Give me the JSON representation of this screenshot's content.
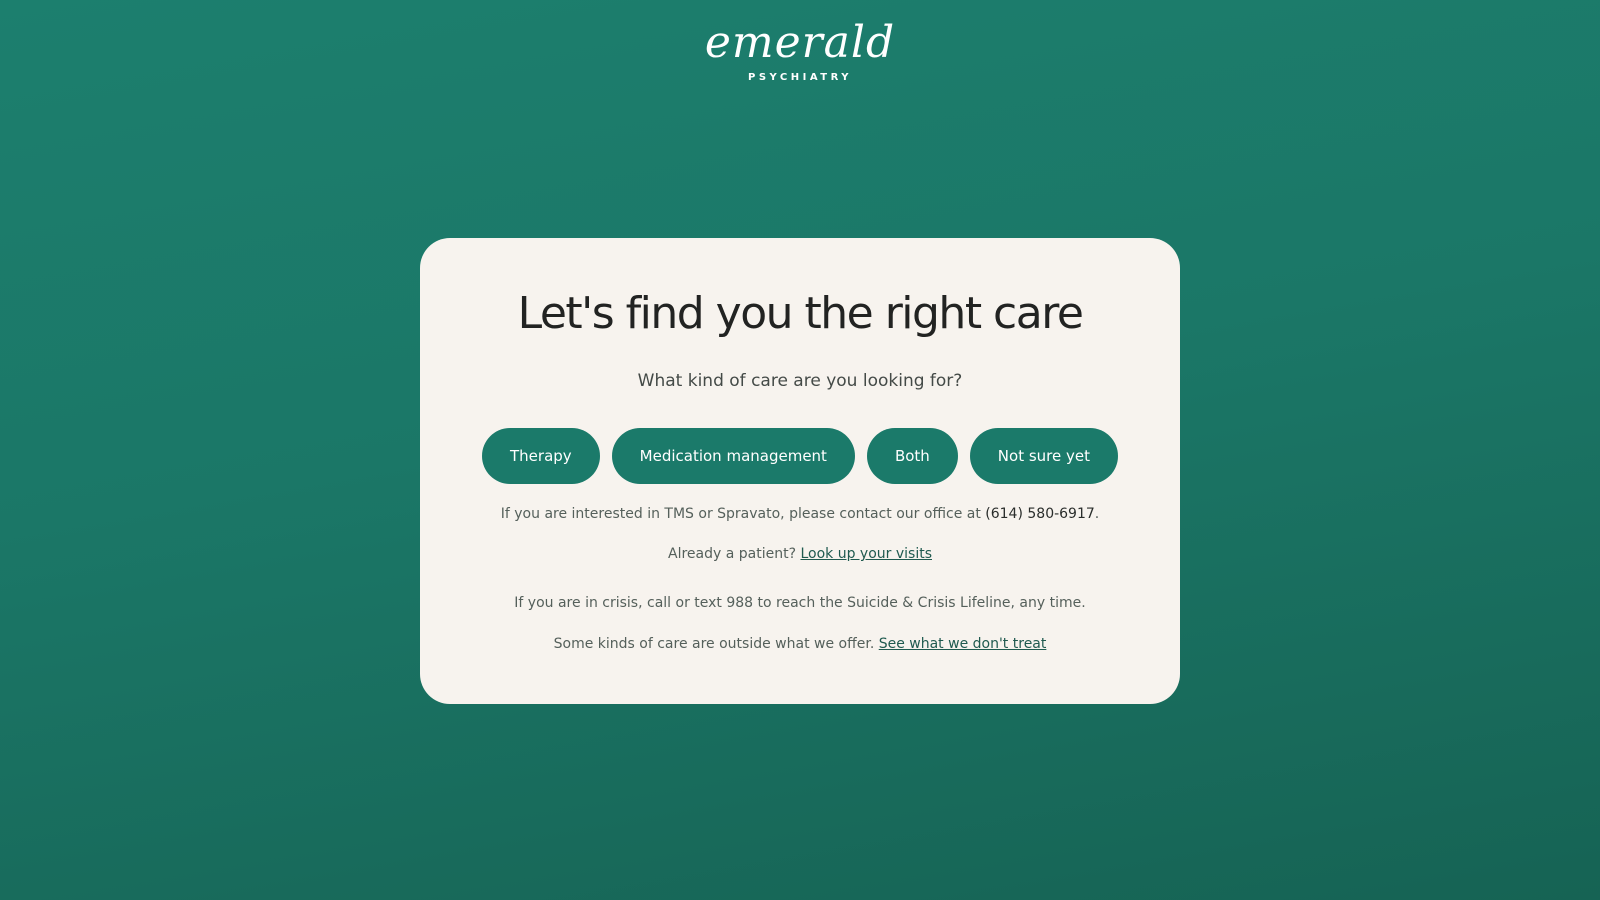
{
  "brand": {
    "name": "emerald",
    "tagline": "PSYCHIATRY"
  },
  "card": {
    "title": "Let's find you the right care",
    "question": "What kind of care are you looking for?",
    "options": [
      {
        "label": "Therapy"
      },
      {
        "label": "Medication management"
      },
      {
        "label": "Both"
      },
      {
        "label": "Not sure yet"
      }
    ],
    "tms_text": "If you are interested in TMS or Spravato, please contact our office at",
    "phone": "(614) 580-6917",
    "tms_suffix": ".",
    "patient_prefix": "Already a patient?",
    "patient_link": "Look up your visits",
    "crisis_text": "If you are in crisis, call or text 988 to reach the Suicide & Crisis Lifeline, any time.",
    "outside_prefix": "Some kinds of care are outside what we offer.",
    "outside_link": "See what we don't treat"
  },
  "colors": {
    "background": "#1b7767",
    "card": "#f7f3ee",
    "button": "#1b7a6a"
  }
}
